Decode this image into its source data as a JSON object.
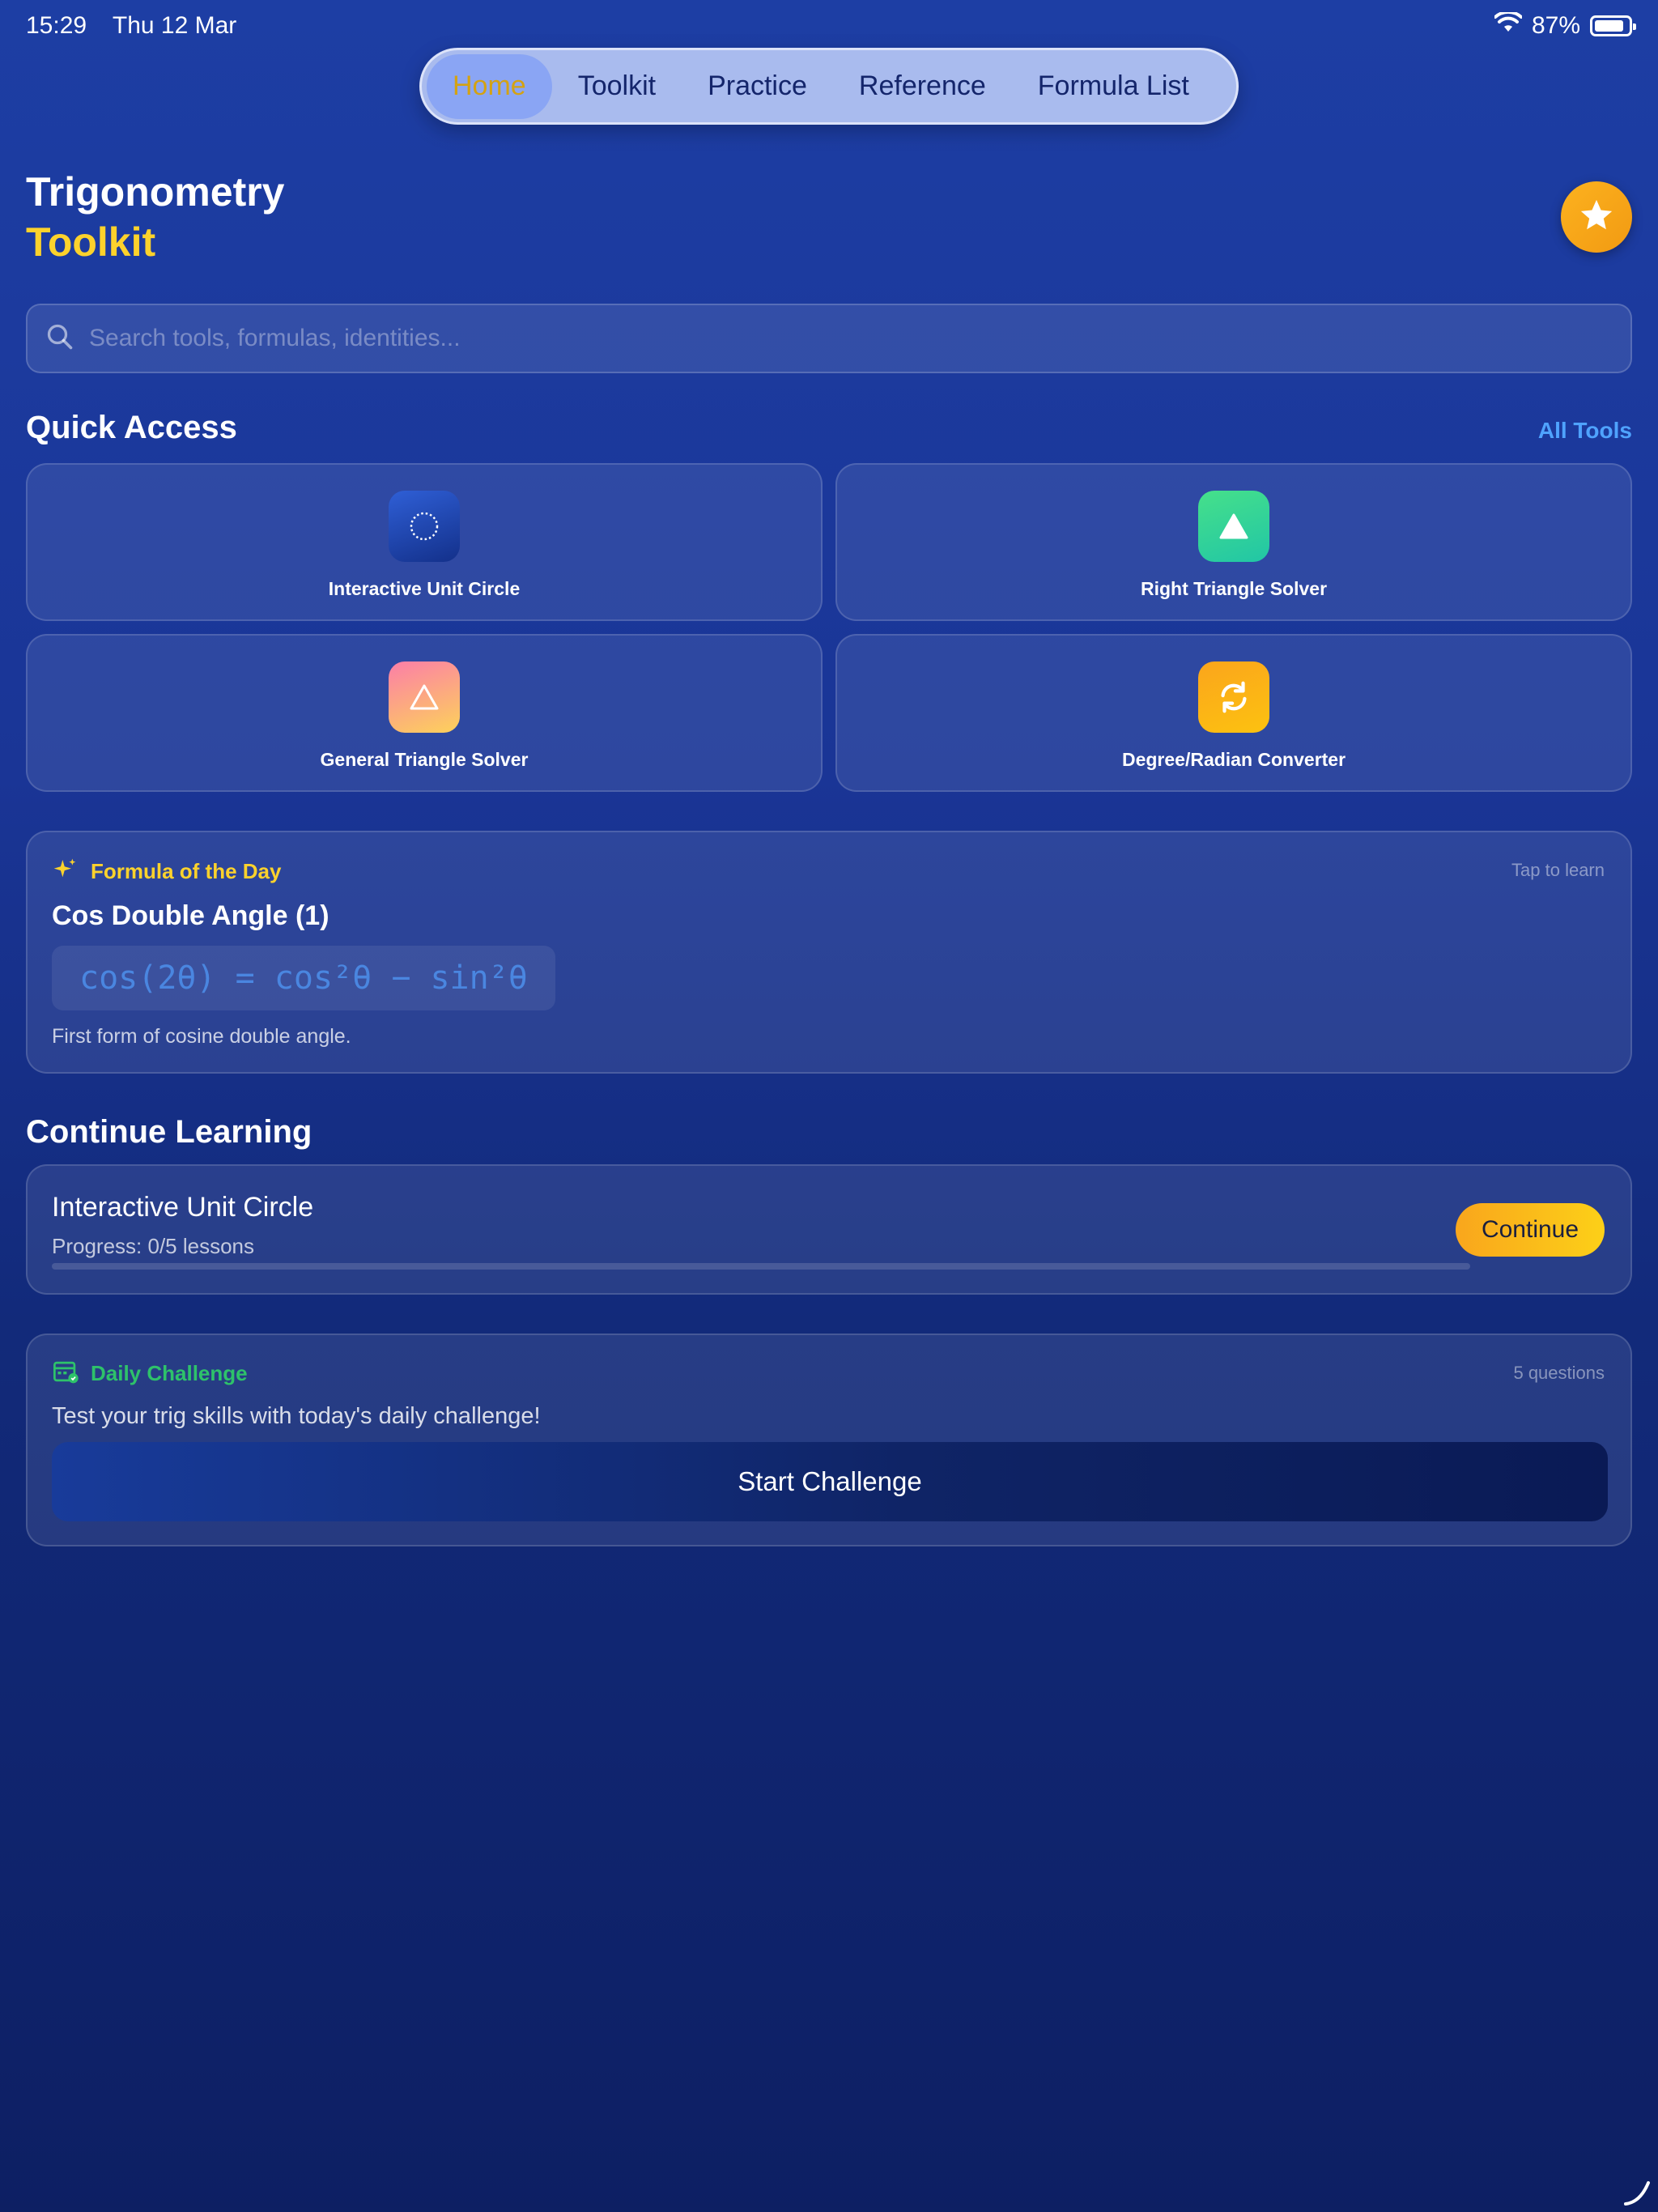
{
  "status": {
    "time": "15:29",
    "date": "Thu 12 Mar",
    "battery": "87%",
    "battery_level": 0.87
  },
  "nav": {
    "tabs": [
      {
        "label": "Home",
        "active": true
      },
      {
        "label": "Toolkit"
      },
      {
        "label": "Practice"
      },
      {
        "label": "Reference"
      },
      {
        "label": "Formula List"
      }
    ]
  },
  "header": {
    "title_line1": "Trigonometry",
    "title_line2": "Toolkit",
    "favorite_icon": "star-icon"
  },
  "search": {
    "placeholder": "Search tools, formulas, identities...",
    "value": ""
  },
  "quick_access": {
    "title": "Quick Access",
    "all_tools_label": "All Tools",
    "tools": [
      {
        "label": "Interactive Unit Circle",
        "icon": "unit-circle-icon"
      },
      {
        "label": "Right Triangle Solver",
        "icon": "right-triangle-icon"
      },
      {
        "label": "General Triangle Solver",
        "icon": "triangle-outline-icon"
      },
      {
        "label": "Degree/Radian Converter",
        "icon": "convert-icon"
      }
    ]
  },
  "formula_of_day": {
    "label": "Formula of the Day",
    "hint": "Tap to learn",
    "name": "Cos Double Angle (1)",
    "formula": "cos(2θ) = cos²θ − sin²θ",
    "description": "First form of cosine double angle."
  },
  "continue_learning": {
    "title": "Continue Learning",
    "item_name": "Interactive Unit Circle",
    "progress_text": "Progress: 0/5 lessons",
    "progress_fraction": 0,
    "button_label": "Continue"
  },
  "daily_challenge": {
    "label": "Daily Challenge",
    "count": "5 questions",
    "description": "Test your trig skills with today's daily challenge!",
    "button_label": "Start Challenge"
  },
  "colors": {
    "accent_yellow": "#fcd22c",
    "accent_blue": "#4fa3ff",
    "accent_green": "#2ec26a",
    "button_orange": "#f9a61c"
  }
}
